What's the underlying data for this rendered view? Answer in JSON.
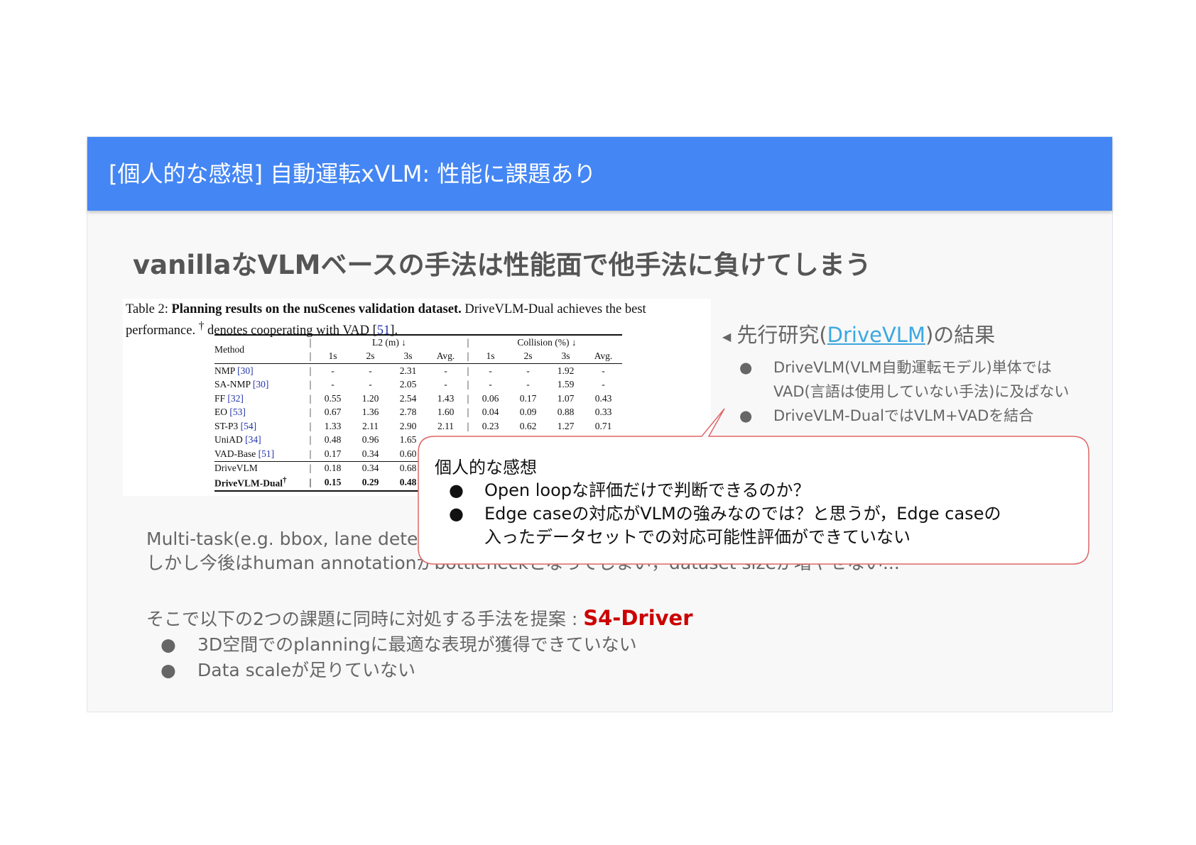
{
  "title": "[個人的な感想] 自動運転xVLM: 性能に課題あり",
  "subtitle": "vanillaなVLMベースの手法は性能面で他手法に負けてしまう",
  "paper": {
    "caption_prefix": "Table 2: ",
    "caption_bold": "Planning results on the nuScenes validation dataset.",
    "caption_rest": " DriveVLM-Dual achieves the best performance. ",
    "caption_dagger": "†",
    "caption_end": " denotes cooperating with VAD [",
    "caption_cite": "51",
    "caption_close": "].",
    "headers": {
      "method": "Method",
      "l2": "L2 (m) ↓",
      "collision": "Collision (%) ↓",
      "sub": [
        "1s",
        "2s",
        "3s",
        "Avg.",
        "1s",
        "2s",
        "3s",
        "Avg."
      ]
    },
    "rows": [
      {
        "name": "NMP ",
        "cite": "[30]",
        "vals": [
          "-",
          "-",
          "2.31",
          "-",
          "-",
          "-",
          "1.92",
          "-"
        ]
      },
      {
        "name": "SA-NMP ",
        "cite": "[30]",
        "vals": [
          "-",
          "-",
          "2.05",
          "-",
          "-",
          "-",
          "1.59",
          "-"
        ]
      },
      {
        "name": "FF ",
        "cite": "[32]",
        "vals": [
          "0.55",
          "1.20",
          "2.54",
          "1.43",
          "0.06",
          "0.17",
          "1.07",
          "0.43"
        ]
      },
      {
        "name": "EO ",
        "cite": "[53]",
        "vals": [
          "0.67",
          "1.36",
          "2.78",
          "1.60",
          "0.04",
          "0.09",
          "0.88",
          "0.33"
        ]
      },
      {
        "name": "ST-P3 ",
        "cite": "[54]",
        "vals": [
          "1.33",
          "2.11",
          "2.90",
          "2.11",
          "0.23",
          "0.62",
          "1.27",
          "0.71"
        ]
      },
      {
        "name": "UniAD ",
        "cite": "[34]",
        "vals": [
          "0.48",
          "0.96",
          "1.65",
          "",
          "",
          "",
          "",
          ""
        ]
      },
      {
        "name": "VAD-Base ",
        "cite": "[51]",
        "vals": [
          "0.17",
          "0.34",
          "0.60",
          "",
          "",
          "",
          "",
          ""
        ]
      },
      {
        "name": "DriveVLM",
        "cite": "",
        "vals": [
          "0.18",
          "0.34",
          "0.68",
          "",
          "",
          "",
          "",
          ""
        ]
      },
      {
        "name": "DriveVLM-Dual",
        "cite": "†",
        "vals": [
          "0.15",
          "0.29",
          "0.48",
          "",
          "",
          "",
          "",
          ""
        ]
      }
    ]
  },
  "right_note": {
    "heading_pre": "先行研究(",
    "heading_link": "DriveVLM",
    "heading_post": ")の結果",
    "bullets": [
      "DriveVLM(VLM自動運転モデル)単体では",
      "VAD(言語は使用していない手法)に及ばない",
      "DriveVLM-DualではVLM+VADを結合"
    ]
  },
  "callout": {
    "heading": "個人的な感想",
    "bullet1": "Open loopな評価だけで判断できるのか？",
    "bullet2_line1": "Edge caseの対応がVLMの強みなのでは？と思うが，Edge caseの",
    "bullet2_line2": "入ったデータセットでの対応可能性評価ができていない"
  },
  "body": {
    "line1": "Multi-task(e.g. bbox, lane detec",
    "line2": "しかし今後はhuman annotationがbottleneckとなってしまい，dataset sizeが増やせない...",
    "proposal_prefix": "そこで以下の2つの課題に同時に対処する手法を提案 : ",
    "proposal_name": "S4-Driver",
    "bullets": [
      "3D空間でのplanningに最適な表現が獲得できていない",
      "Data scaleが足りていない"
    ]
  },
  "bullet_glyph": "●",
  "colors": {
    "title_bar": "#4486f4",
    "accent_red": "#cc0000",
    "callout_border": "#e06666",
    "link": "#3aa8e0"
  }
}
